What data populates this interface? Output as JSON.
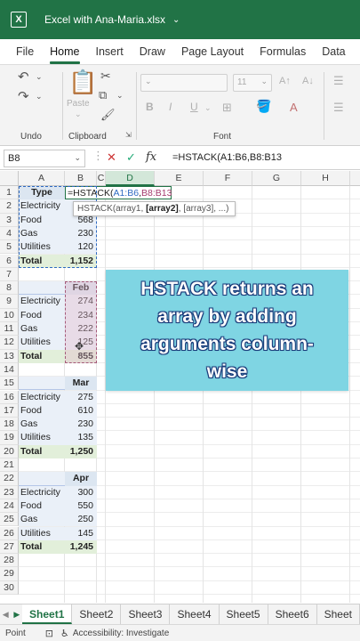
{
  "window": {
    "title": "Excel with Ana-Maria.xlsx",
    "accent": "#217346"
  },
  "tabs": [
    "File",
    "Home",
    "Insert",
    "Draw",
    "Page Layout",
    "Formulas",
    "Data",
    "Re"
  ],
  "ribbon": {
    "undo_label": "Undo",
    "clipboard_label": "Clipboard",
    "paste_label": "Paste",
    "font_label": "Font",
    "font_size": "11"
  },
  "formula_bar": {
    "name_box": "B8",
    "fx": "fx",
    "formula": "=HSTACK(A1:B6,B8:B13"
  },
  "columns": [
    "A",
    "B",
    "C",
    "D",
    "E",
    "F",
    "G",
    "H"
  ],
  "rows": [
    "1",
    "2",
    "3",
    "4",
    "5",
    "6",
    "7",
    "8",
    "9",
    "10",
    "11",
    "12",
    "13",
    "14",
    "15",
    "16",
    "17",
    "18",
    "19",
    "20",
    "21",
    "22",
    "23",
    "24",
    "25",
    "26",
    "27",
    "28",
    "29",
    "30"
  ],
  "cells": {
    "a1": "Type",
    "editing_prefix": "=HSTACK(",
    "editing_ref1": "A1:B6",
    "editing_comma": ",",
    "editing_ref2": "B8:B13",
    "table1": [
      [
        "Electricity",
        ""
      ],
      [
        "Food",
        "568"
      ],
      [
        "Gas",
        "230"
      ],
      [
        "Utilities",
        "120"
      ],
      [
        "Total",
        "1,152"
      ]
    ],
    "t2_header": "Feb",
    "table2": [
      [
        "Electricity",
        "274"
      ],
      [
        "Food",
        "234"
      ],
      [
        "Gas",
        "222"
      ],
      [
        "Utilities",
        "125"
      ],
      [
        "Total",
        "855"
      ]
    ],
    "t3_header": "Mar",
    "table3": [
      [
        "Electricity",
        "275"
      ],
      [
        "Food",
        "610"
      ],
      [
        "Gas",
        "230"
      ],
      [
        "Utilities",
        "135"
      ],
      [
        "Total",
        "1,250"
      ]
    ],
    "t4_header": "Apr",
    "table4": [
      [
        "Electricity",
        "300"
      ],
      [
        "Food",
        "550"
      ],
      [
        "Gas",
        "250"
      ],
      [
        "Utilities",
        "145"
      ],
      [
        "Total",
        "1,245"
      ]
    ]
  },
  "tooltip": {
    "prefix": "HSTACK(array1, ",
    "bold": "[array2]",
    "suffix": ", [array3], ...)"
  },
  "callout": {
    "text": "HSTACK returns an array by adding arguments column-wise",
    "bg": "#7fd5e3"
  },
  "sheets": [
    "Sheet1",
    "Sheet2",
    "Sheet3",
    "Sheet4",
    "Sheet5",
    "Sheet6",
    "Sheet"
  ],
  "status": {
    "mode": "Point",
    "accessibility": "Accessibility: Investigate"
  }
}
